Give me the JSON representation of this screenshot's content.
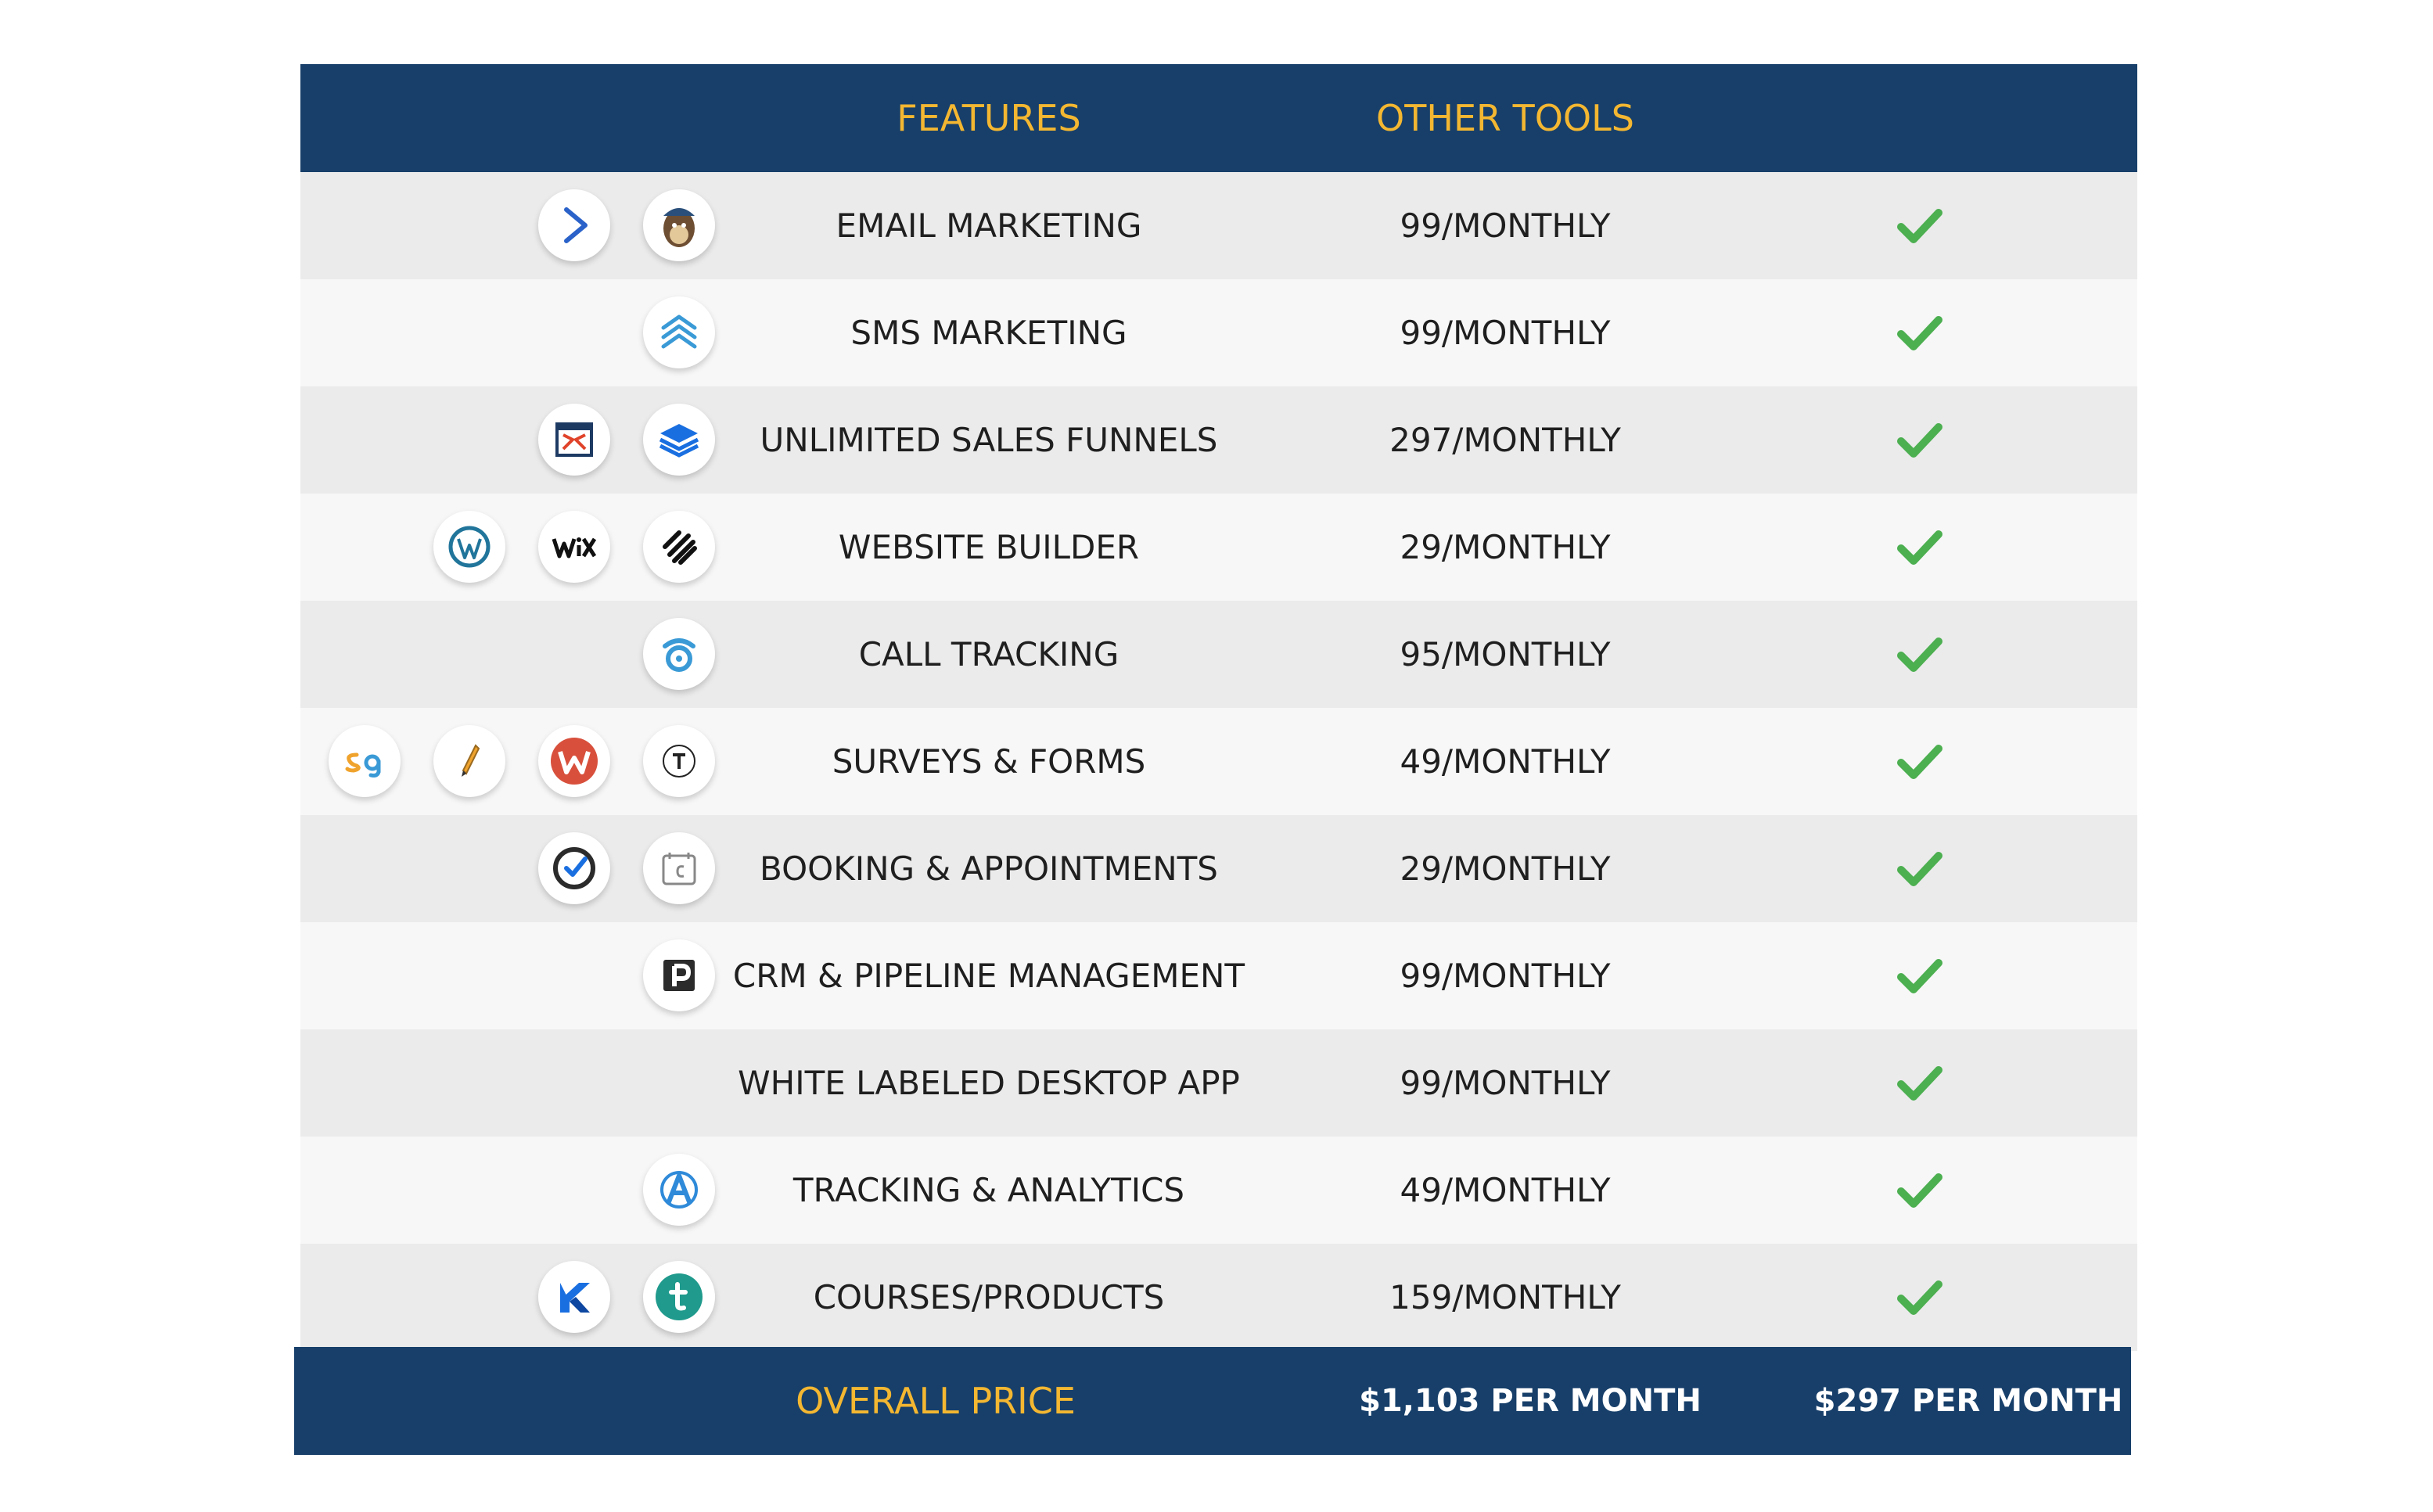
{
  "header": {
    "features_label": "FEATURES",
    "other_tools_label": "OTHER TOOLS"
  },
  "colors": {
    "header_bg": "#173f6a",
    "header_text": "#f4b731",
    "row_odd": "#ebebeb",
    "row_even": "#f7f7f7",
    "check": "#4caf50"
  },
  "rows": [
    {
      "feature": "EMAIL MARKETING",
      "price": "99/MONTHLY",
      "included": true,
      "icons": [
        "activecampaign-icon",
        "mailchimp-icon"
      ]
    },
    {
      "feature": "SMS MARKETING",
      "price": "99/MONTHLY",
      "included": true,
      "icons": [
        "chevrons-up-icon"
      ]
    },
    {
      "feature": "UNLIMITED SALES FUNNELS",
      "price": "297/MONTHLY",
      "included": true,
      "icons": [
        "clickfunnels-icon",
        "layers-icon"
      ]
    },
    {
      "feature": "WEBSITE BUILDER",
      "price": "29/MONTHLY",
      "included": true,
      "icons": [
        "wordpress-icon",
        "wix-icon",
        "squarespace-icon"
      ]
    },
    {
      "feature": "CALL TRACKING",
      "price": "95/MONTHLY",
      "included": true,
      "icons": [
        "call-tracking-icon"
      ]
    },
    {
      "feature": "SURVEYS & FORMS",
      "price": "49/MONTHLY",
      "included": true,
      "icons": [
        "surveygizmo-icon",
        "pen-icon",
        "wufoo-icon",
        "typeform-icon"
      ]
    },
    {
      "feature": "BOOKING & APPOINTMENTS",
      "price": "29/MONTHLY",
      "included": true,
      "icons": [
        "check-circle-icon",
        "calendar-icon"
      ]
    },
    {
      "feature": "CRM & PIPELINE MANAGEMENT",
      "price": "99/MONTHLY",
      "included": true,
      "icons": [
        "pipedrive-icon"
      ]
    },
    {
      "feature": "WHITE LABELED DESKTOP APP",
      "price": "99/MONTHLY",
      "included": true,
      "icons": []
    },
    {
      "feature": "TRACKING & ANALYTICS",
      "price": "49/MONTHLY",
      "included": true,
      "icons": [
        "analytics-icon"
      ]
    },
    {
      "feature": "COURSES/PRODUCTS",
      "price": "159/MONTHLY",
      "included": true,
      "icons": [
        "kajabi-icon",
        "teachable-icon"
      ]
    }
  ],
  "footer": {
    "label": "OVERALL PRICE",
    "other_price": "$1,103 PER MONTH",
    "our_price": "$297 PER MONTH"
  }
}
